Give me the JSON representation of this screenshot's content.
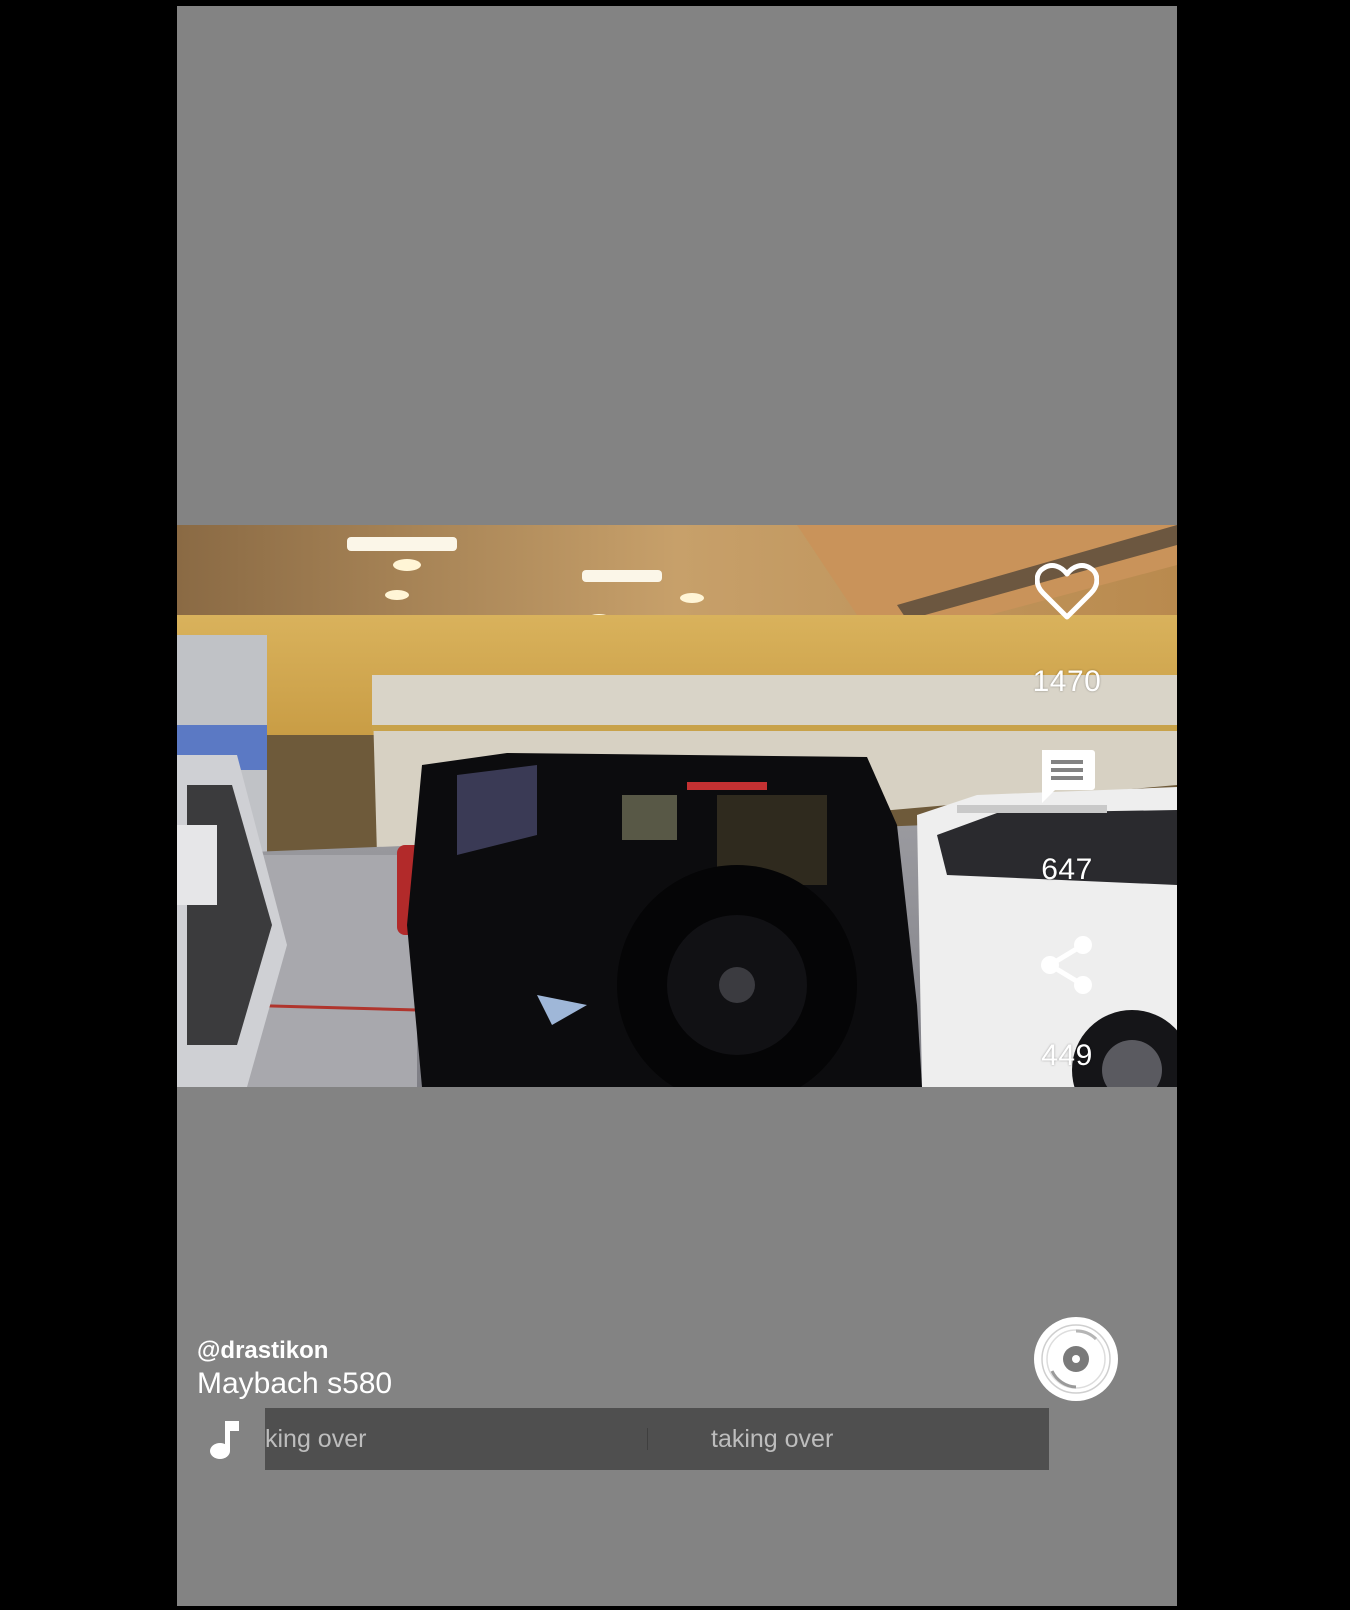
{
  "post": {
    "author_handle": "@drastikon",
    "caption": "Maybach s580"
  },
  "actions": {
    "like_count": "1470",
    "comment_count": "647",
    "share_count": "449"
  },
  "music": {
    "track_fragment": "king over",
    "track_title": "taking over"
  },
  "icons": {
    "like": "heart-outline-icon",
    "comment": "comment-bubble-icon",
    "share": "share-icon",
    "music": "music-note-icon",
    "disc": "music-disc-icon"
  },
  "colors": {
    "background": "#000000",
    "frame": "#838383",
    "marquee_bg": "#4f4f4f",
    "text": "#ffffff",
    "marquee_text": "#bdbdbd"
  }
}
